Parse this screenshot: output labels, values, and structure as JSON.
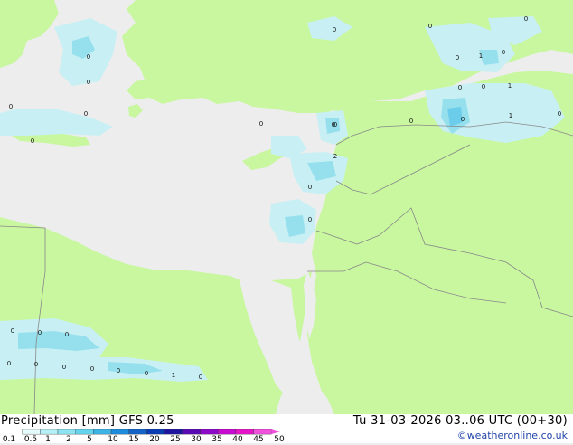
{
  "header": {
    "left_title": "Precipitation [mm]  GFS 0.25",
    "right_title": "Tu 31-03-2026 03..06 UTC (00+30)",
    "credit": "©weatheronline.co.uk"
  },
  "legend": {
    "ticks": [
      "0.1",
      "0.5",
      "1",
      "2",
      "5",
      "10",
      "15",
      "20",
      "25",
      "30",
      "35",
      "40",
      "45",
      "50"
    ],
    "colors": [
      "#e6fbfb",
      "#b4f0f6",
      "#8ce4f2",
      "#64d4ee",
      "#3cb4e6",
      "#1e8cdc",
      "#1464c8",
      "#0a3cb4",
      "#1e14a0",
      "#5a0ab4",
      "#8c0ac8",
      "#c80ad2",
      "#e614c8",
      "#f050dc"
    ]
  },
  "map_labels": [
    {
      "text": "0"
    },
    {
      "text": "0"
    },
    {
      "text": "0"
    },
    {
      "text": "0"
    },
    {
      "text": "0"
    },
    {
      "text": "0"
    },
    {
      "text": "0"
    },
    {
      "text": "0"
    },
    {
      "text": "0"
    },
    {
      "text": "0"
    },
    {
      "text": "1"
    },
    {
      "text": "0"
    },
    {
      "text": "0"
    },
    {
      "text": "0"
    },
    {
      "text": "1"
    },
    {
      "text": "0"
    },
    {
      "text": "0"
    },
    {
      "text": "1"
    },
    {
      "text": "0"
    },
    {
      "text": "0"
    },
    {
      "text": "2"
    },
    {
      "text": "0"
    },
    {
      "text": "0"
    },
    {
      "text": "0"
    },
    {
      "text": "0"
    },
    {
      "text": "0"
    },
    {
      "text": "0"
    },
    {
      "text": "0"
    },
    {
      "text": "0"
    },
    {
      "text": "0"
    },
    {
      "text": "0"
    },
    {
      "text": "0"
    },
    {
      "text": "1"
    },
    {
      "text": "0"
    },
    {
      "text": "0"
    }
  ],
  "colors": {
    "land": "#c8f7a0",
    "sea": "#ededed",
    "border": "#888888",
    "precip_light": "#c8f0f4",
    "precip_mid": "#96e0ee",
    "precip_strong": "#6ccdea"
  }
}
